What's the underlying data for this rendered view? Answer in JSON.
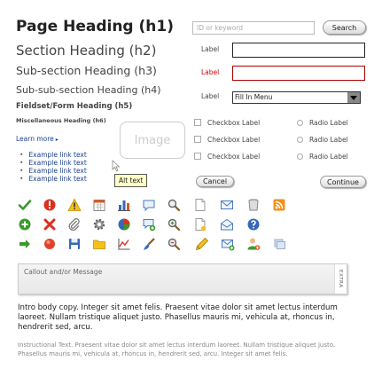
{
  "headings": {
    "h1": "Page Heading (h1)",
    "h2": "Section Heading (h2)",
    "h3": "Sub-section Heading (h3)",
    "h4": "Sub-sub-section Heading (h4)",
    "h5": "Fieldset/Form Heading (h5)",
    "h6": "Miscellaneous Heading (h6)"
  },
  "learn_more": "Learn more",
  "links": [
    "Example link text",
    "Example link text",
    "Example link text",
    "Example link text"
  ],
  "image_placeholder": "Image",
  "tooltip": "Alt text",
  "search": {
    "placeholder": "ID or keyword",
    "button": "Search"
  },
  "form": {
    "label_1": "Label",
    "label_2": "Label",
    "label_3": "Label",
    "select_value": "Fill In Menu",
    "checkbox_labels": [
      "Checkbox Label",
      "Checkbox Label",
      "Checkbox Label"
    ],
    "radio_labels": [
      "Radio Label",
      "Radio Label",
      "Radio Label"
    ],
    "cancel": "Cancel",
    "continue": "Continue",
    "error_color": "#cc0000"
  },
  "icons": {
    "row1": [
      "check-icon",
      "alert-circle-icon",
      "warning-icon",
      "calendar-icon",
      "bar-chart-icon",
      "speech-bubble-icon",
      "magnifier-icon",
      "document-icon",
      "email-icon",
      "trash-icon",
      "rss-icon"
    ],
    "row2": [
      "add-circle-icon",
      "delete-x-icon",
      "paperclip-icon",
      "gear-icon",
      "pie-chart-icon",
      "comment-add-icon",
      "zoom-in-icon",
      "new-document-icon",
      "mail-open-icon",
      "help-icon"
    ],
    "row3": [
      "arrow-right-icon",
      "record-icon",
      "save-icon",
      "folder-icon",
      "line-chart-icon",
      "paint-brush-icon",
      "zoom-out-icon",
      "pencil-icon",
      "mail-add-icon",
      "user-add-icon",
      "windows-icon"
    ]
  },
  "callout": {
    "text": "Callout and/or  Message",
    "side_label": "EXTRA"
  },
  "body_text": "Intro body copy. Integer sit amet felis. Praesent vitae dolor sit amet lectus interdum laoreet. Nullam tristique aliquet justo. Phasellus mauris mi, vehicula at, rhoncus in, hendrerit sed, arcu.",
  "instructional_text": "Instructional Text. Praesent vitae dolor sit amet lectus interdum laoreet. Nullam tristique aliquet justo. Phasellus mauris mi, vehicula at, rhoncus in, hendrerit sed, arcu. Integer sit amet felis."
}
